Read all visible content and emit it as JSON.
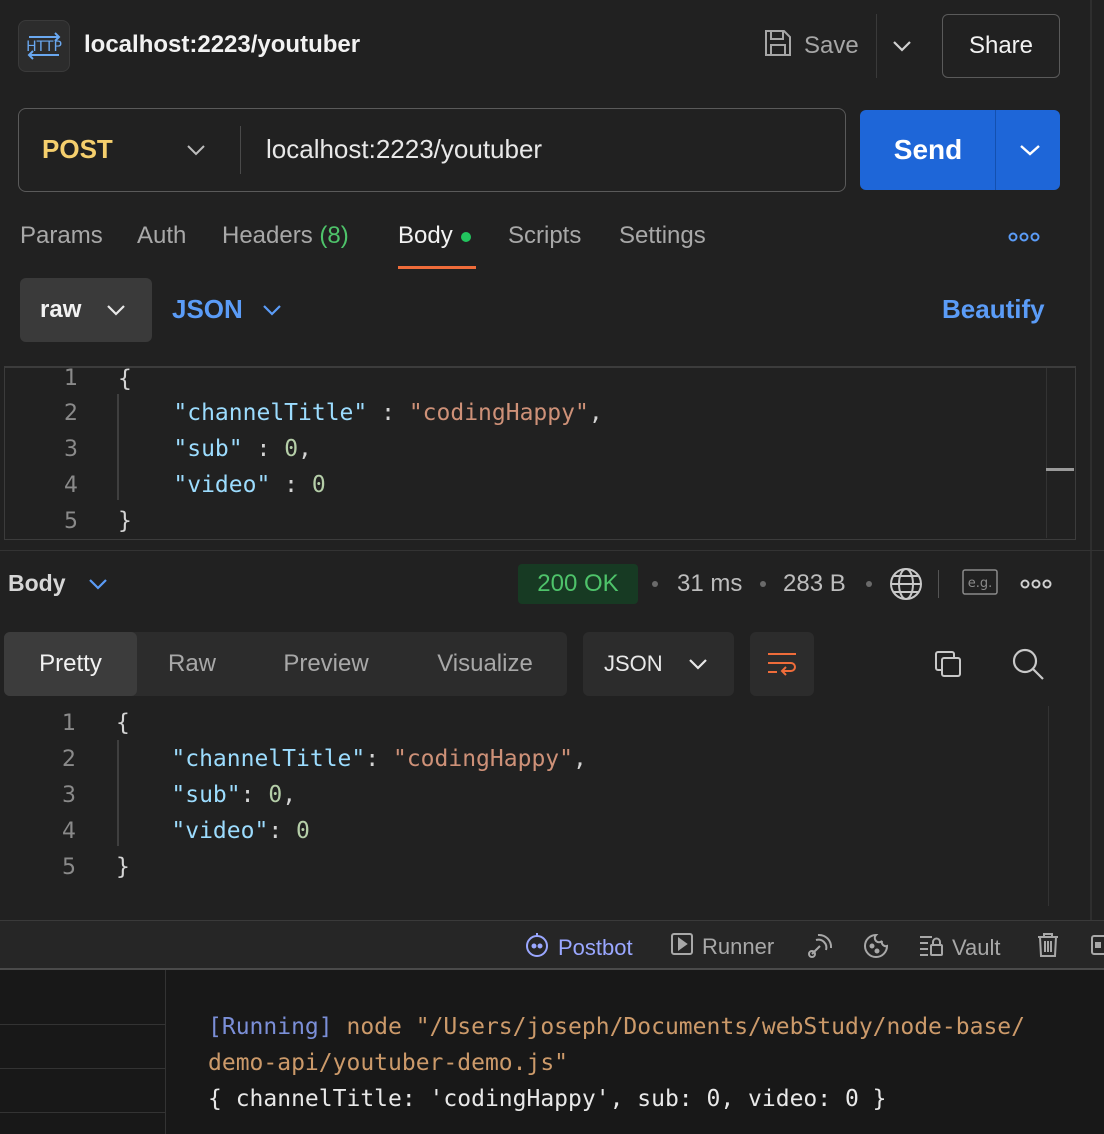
{
  "header": {
    "http_icon_text": "HTTP",
    "tab_title": "localhost:2223/youtuber",
    "save_label": "Save",
    "share_label": "Share"
  },
  "request": {
    "method": "POST",
    "url": "localhost:2223/youtuber",
    "send_label": "Send",
    "tabs": [
      {
        "label": "Params"
      },
      {
        "label": "Auth"
      },
      {
        "label": "Headers",
        "count": "(8)"
      },
      {
        "label": "Body",
        "active": true
      },
      {
        "label": "Scripts"
      },
      {
        "label": "Settings"
      }
    ],
    "body_mode": "raw",
    "body_format": "JSON",
    "beautify_label": "Beautify",
    "editor": {
      "line_numbers": [
        "1",
        "2",
        "3",
        "4",
        "5"
      ],
      "lines": [
        {
          "indent": "",
          "key": "",
          "sep": "",
          "value": "",
          "punc": "{"
        },
        {
          "indent": "    ",
          "key": "\"channelTitle\"",
          "sep": " : ",
          "value": "\"codingHappy\"",
          "punc": ","
        },
        {
          "indent": "    ",
          "key": "\"sub\"",
          "sep": " : ",
          "value": "0",
          "punc": ","
        },
        {
          "indent": "    ",
          "key": "\"video\"",
          "sep": " : ",
          "value": "0",
          "punc": ""
        },
        {
          "indent": "",
          "key": "",
          "sep": "",
          "value": "",
          "punc": "}"
        }
      ]
    }
  },
  "response": {
    "section_label": "Body",
    "status": "200 OK",
    "time": "31 ms",
    "size": "283 B",
    "example_label": "e.g.",
    "view_tabs": [
      "Pretty",
      "Raw",
      "Preview",
      "Visualize"
    ],
    "active_view": "Pretty",
    "format": "JSON",
    "editor": {
      "line_numbers": [
        "1",
        "2",
        "3",
        "4",
        "5"
      ],
      "lines": [
        {
          "indent": "",
          "key": "",
          "sep": "",
          "value": "",
          "punc": "{"
        },
        {
          "indent": "    ",
          "key": "\"channelTitle\"",
          "sep": ": ",
          "value": "\"codingHappy\"",
          "punc": ","
        },
        {
          "indent": "    ",
          "key": "\"sub\"",
          "sep": ": ",
          "value": "0",
          "punc": ","
        },
        {
          "indent": "    ",
          "key": "\"video\"",
          "sep": ": ",
          "value": "0",
          "punc": ""
        },
        {
          "indent": "",
          "key": "",
          "sep": "",
          "value": "",
          "punc": "}"
        }
      ]
    }
  },
  "statusbar": {
    "postbot": "Postbot",
    "runner": "Runner",
    "vault": "Vault"
  },
  "terminal": {
    "running_tag": "[Running]",
    "command_1": " node \"/Users/joseph/Documents/webStudy/node-base/",
    "command_2": "demo-api/youtuber-demo.js\"",
    "output": "{ channelTitle: 'codingHappy', sub: 0, video: 0 }"
  },
  "colors": {
    "accent_send": "#1e66d8",
    "method": "#f5cf6d",
    "link_blue": "#5b9cf7",
    "status_green": "#4ec36a",
    "tab_underline": "#ef6c3a"
  }
}
